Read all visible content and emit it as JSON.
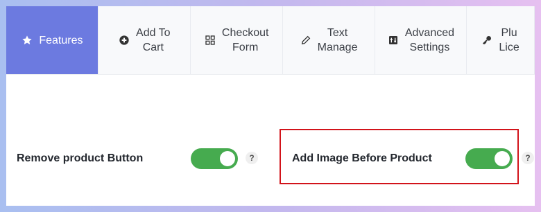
{
  "tabs": [
    {
      "label_line1": "Features",
      "label_line2": "",
      "icon": "star-icon",
      "active": true
    },
    {
      "label_line1": "Add To",
      "label_line2": "Cart",
      "icon": "plus-circle-icon",
      "active": false
    },
    {
      "label_line1": "Checkout",
      "label_line2": "Form",
      "icon": "grid-icon",
      "active": false
    },
    {
      "label_line1": "Text",
      "label_line2": "Manage",
      "icon": "pencil-icon",
      "active": false
    },
    {
      "label_line1": "Advanced",
      "label_line2": "Settings",
      "icon": "settings-box-icon",
      "active": false
    },
    {
      "label_line1": "Plu",
      "label_line2": "Lice",
      "icon": "key-icon",
      "active": false
    }
  ],
  "settings": {
    "remove_product_button": {
      "label": "Remove product Button",
      "enabled": true,
      "help": "?"
    },
    "add_image_before_product": {
      "label": "Add Image Before Product",
      "enabled": true,
      "help": "?"
    }
  },
  "colors": {
    "accent": "#6c7ae0",
    "toggle_on": "#46ab4f",
    "highlight": "#d2131a"
  }
}
